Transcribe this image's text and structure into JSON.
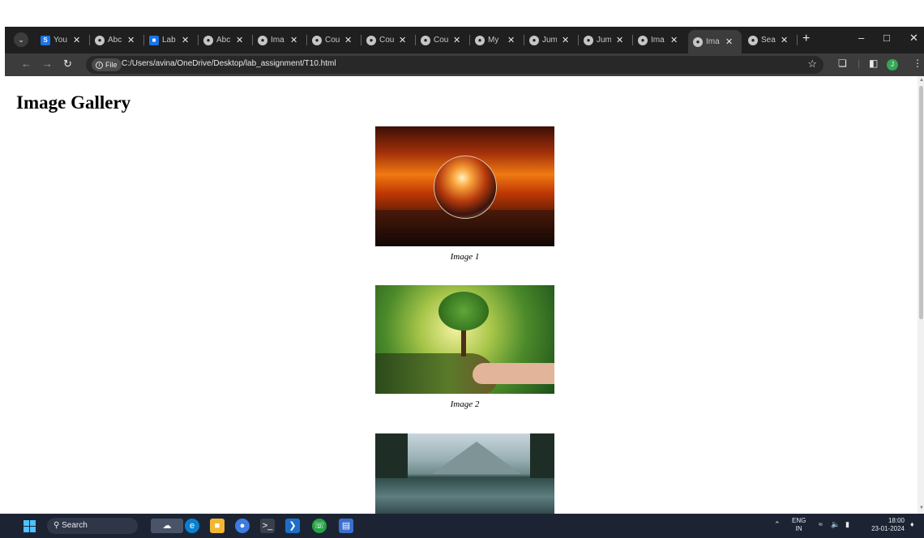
{
  "browser": {
    "tabs": [
      {
        "label": "You",
        "icon": "s-icon"
      },
      {
        "label": "Abc",
        "icon": "globe-icon"
      },
      {
        "label": "Lab",
        "icon": "classroom-icon"
      },
      {
        "label": "Abc",
        "icon": "globe-icon"
      },
      {
        "label": "Ima",
        "icon": "globe-icon"
      },
      {
        "label": "Cou",
        "icon": "globe-icon"
      },
      {
        "label": "Cou",
        "icon": "globe-icon"
      },
      {
        "label": "Cou",
        "icon": "globe-icon"
      },
      {
        "label": "My",
        "icon": "globe-icon"
      },
      {
        "label": "Jum",
        "icon": "globe-icon"
      },
      {
        "label": "Jum",
        "icon": "globe-icon"
      },
      {
        "label": "Ima",
        "icon": "globe-icon"
      },
      {
        "label": "Ima",
        "icon": "globe-icon",
        "active": true
      },
      {
        "label": "Sea",
        "icon": "globe-icon"
      }
    ],
    "omnibox": {
      "chip": "File",
      "url": "C:/Users/avina/OneDrive/Desktop/lab_assignment/T10.html"
    },
    "profile_initial": "J"
  },
  "page": {
    "heading": "Image Gallery",
    "images": [
      {
        "caption": "Image 1"
      },
      {
        "caption": "Image 2"
      },
      {
        "caption": ""
      }
    ]
  },
  "taskbar": {
    "search_label": "Search",
    "lang_line1": "ENG",
    "lang_line2": "IN",
    "time": "18:00",
    "date": "23-01-2024"
  }
}
